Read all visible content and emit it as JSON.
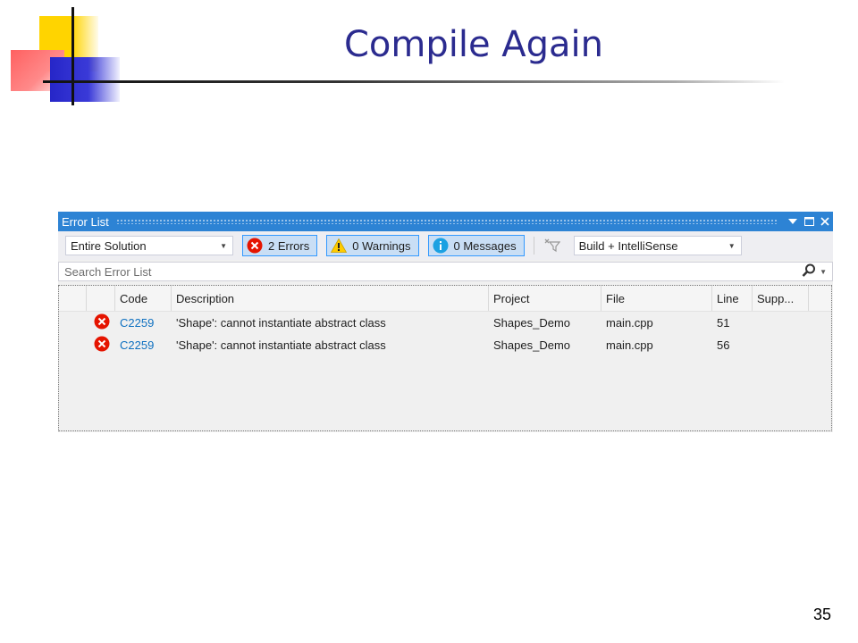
{
  "slide": {
    "title": "Compile Again",
    "page_number": "35"
  },
  "error_list": {
    "title": "Error List",
    "window_buttons": [
      "dropdown",
      "maximize",
      "close"
    ],
    "scope_combo": {
      "value": "Entire Solution"
    },
    "filters": {
      "errors": "2 Errors",
      "warnings": "0 Warnings",
      "messages": "0 Messages"
    },
    "source_combo": {
      "value": "Build + IntelliSense"
    },
    "search": {
      "placeholder": "Search Error List"
    },
    "columns": [
      "Code",
      "Description",
      "Project",
      "File",
      "Line",
      "Supp..."
    ],
    "rows": [
      {
        "code": "C2259",
        "description": "'Shape': cannot instantiate abstract class",
        "project": "Shapes_Demo",
        "file": "main.cpp",
        "line": "51",
        "supp": ""
      },
      {
        "code": "C2259",
        "description": "'Shape': cannot instantiate abstract class",
        "project": "Shapes_Demo",
        "file": "main.cpp",
        "line": "56",
        "supp": ""
      }
    ],
    "colors": {
      "titlebar": "#2d83d4",
      "error_icon": "#e51400",
      "warning_icon": "#ffcc00",
      "info_icon": "#1ba1e2",
      "link": "#0e70c0",
      "slide_title": "#2b2b8f"
    }
  }
}
